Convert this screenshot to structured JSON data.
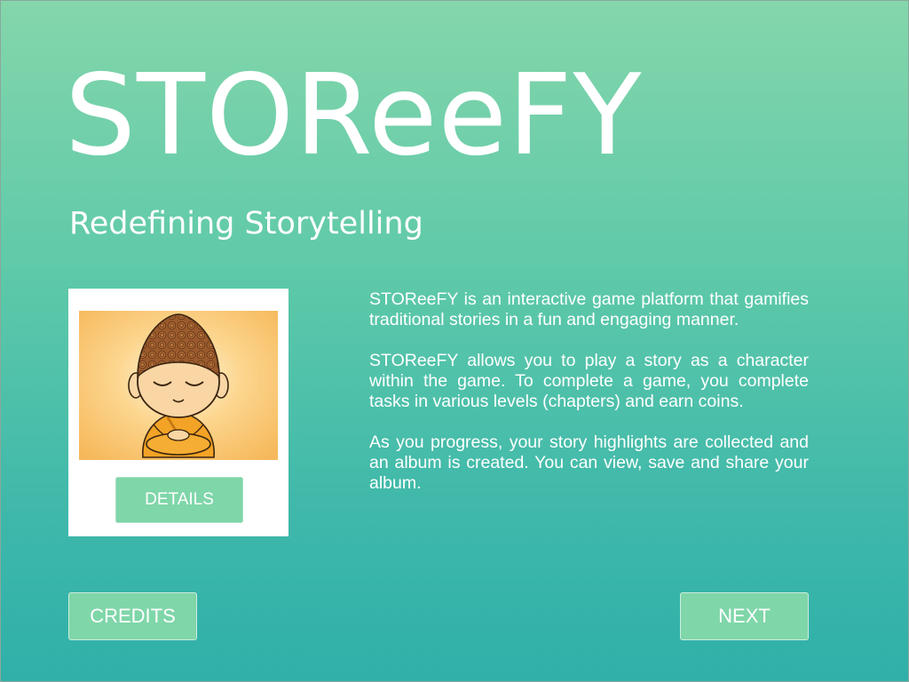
{
  "app": {
    "title": "STOReeFY",
    "subtitle": "Redefining Storytelling"
  },
  "card": {
    "image_icon": "meditating-monk-illustration",
    "details_label": "DETAILS"
  },
  "description": {
    "paragraphs": [
      "STOReeFY is an interactive game platform that gamifies traditional stories in a fun and engaging manner.",
      "STOReeFY allows you to play a story as a character within the game. To complete a game, you complete tasks in various levels (chapters) and earn coins.",
      "As you progress, your story highlights are collected and an album is created. You can view, save and share your album."
    ]
  },
  "footer": {
    "credits_label": "CREDITS",
    "next_label": "NEXT"
  },
  "colors": {
    "gradient_top": "#84d6ab",
    "gradient_bottom": "#2fb0a9",
    "button": "#7fd6a9",
    "text": "#ffffff"
  }
}
